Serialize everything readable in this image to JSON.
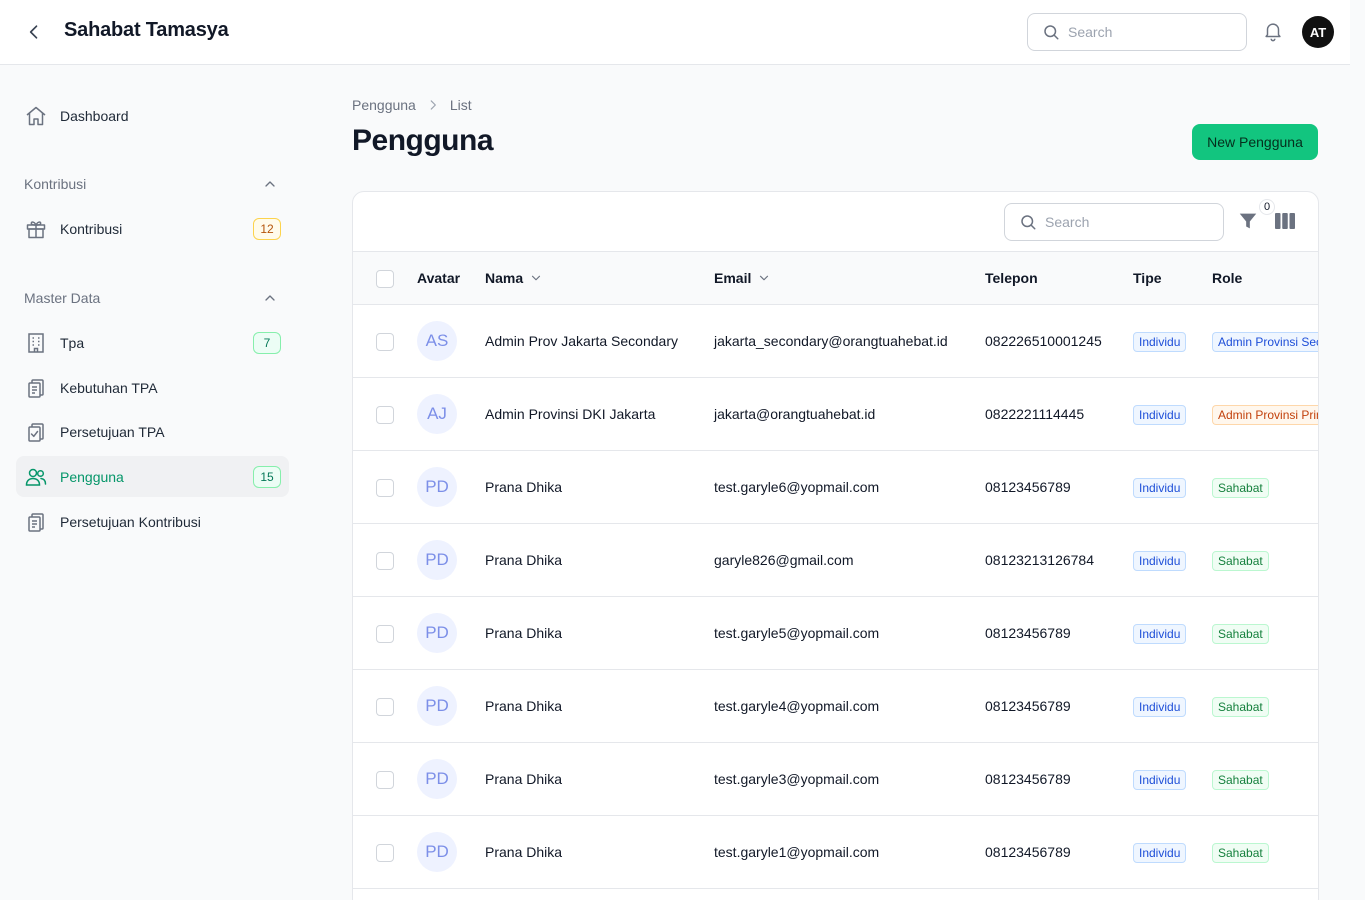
{
  "app": {
    "title": "Sahabat Tamasya",
    "user_initials": "AT"
  },
  "topbar": {
    "search_placeholder": "Search"
  },
  "sidebar": {
    "dashboard": {
      "label": "Dashboard"
    },
    "group_kontribusi": {
      "label": "Kontribusi"
    },
    "kontribusi": {
      "label": "Kontribusi",
      "badge": "12"
    },
    "group_master": {
      "label": "Master Data"
    },
    "tpa": {
      "label": "Tpa",
      "badge": "7"
    },
    "kebutuhan": {
      "label": "Kebutuhan TPA"
    },
    "persetujuan_tpa": {
      "label": "Persetujuan TPA"
    },
    "pengguna": {
      "label": "Pengguna",
      "badge": "15"
    },
    "persetujuan_kontribusi": {
      "label": "Persetujuan Kontribusi"
    }
  },
  "breadcrumb": {
    "first": "Pengguna",
    "second": "List"
  },
  "page": {
    "title": "Pengguna",
    "new_button": "New Pengguna"
  },
  "table": {
    "search_placeholder": "Search",
    "filter_count": "0",
    "columns": {
      "avatar": "Avatar",
      "nama": "Nama",
      "email": "Email",
      "telepon": "Telepon",
      "tipe": "Tipe",
      "role": "Role"
    },
    "rows": [
      {
        "initials": "AS",
        "nama": "Admin Prov Jakarta Secondary",
        "email": "jakarta_secondary@orangtuahebat.id",
        "telepon": "082226510001245",
        "tipe": "Individu",
        "role": "Admin Provinsi Secondary"
      },
      {
        "initials": "AJ",
        "nama": "Admin Provinsi DKI Jakarta",
        "email": "jakarta@orangtuahebat.id",
        "telepon": "0822221114445",
        "tipe": "Individu",
        "role": "Admin Provinsi Primary"
      },
      {
        "initials": "PD",
        "nama": "Prana Dhika",
        "email": "test.garyle6@yopmail.com",
        "telepon": "08123456789",
        "tipe": "Individu",
        "role": "Sahabat"
      },
      {
        "initials": "PD",
        "nama": "Prana Dhika",
        "email": "garyle826@gmail.com",
        "telepon": "08123213126784",
        "tipe": "Individu",
        "role": "Sahabat"
      },
      {
        "initials": "PD",
        "nama": "Prana Dhika",
        "email": "test.garyle5@yopmail.com",
        "telepon": "08123456789",
        "tipe": "Individu",
        "role": "Sahabat"
      },
      {
        "initials": "PD",
        "nama": "Prana Dhika",
        "email": "test.garyle4@yopmail.com",
        "telepon": "08123456789",
        "tipe": "Individu",
        "role": "Sahabat"
      },
      {
        "initials": "PD",
        "nama": "Prana Dhika",
        "email": "test.garyle3@yopmail.com",
        "telepon": "08123456789",
        "tipe": "Individu",
        "role": "Sahabat"
      },
      {
        "initials": "PD",
        "nama": "Prana Dhika",
        "email": "test.garyle1@yopmail.com",
        "telepon": "08123456789",
        "tipe": "Individu",
        "role": "Sahabat"
      }
    ]
  },
  "colors": {
    "accent": "#059669",
    "primary_button": "#12c57f"
  }
}
